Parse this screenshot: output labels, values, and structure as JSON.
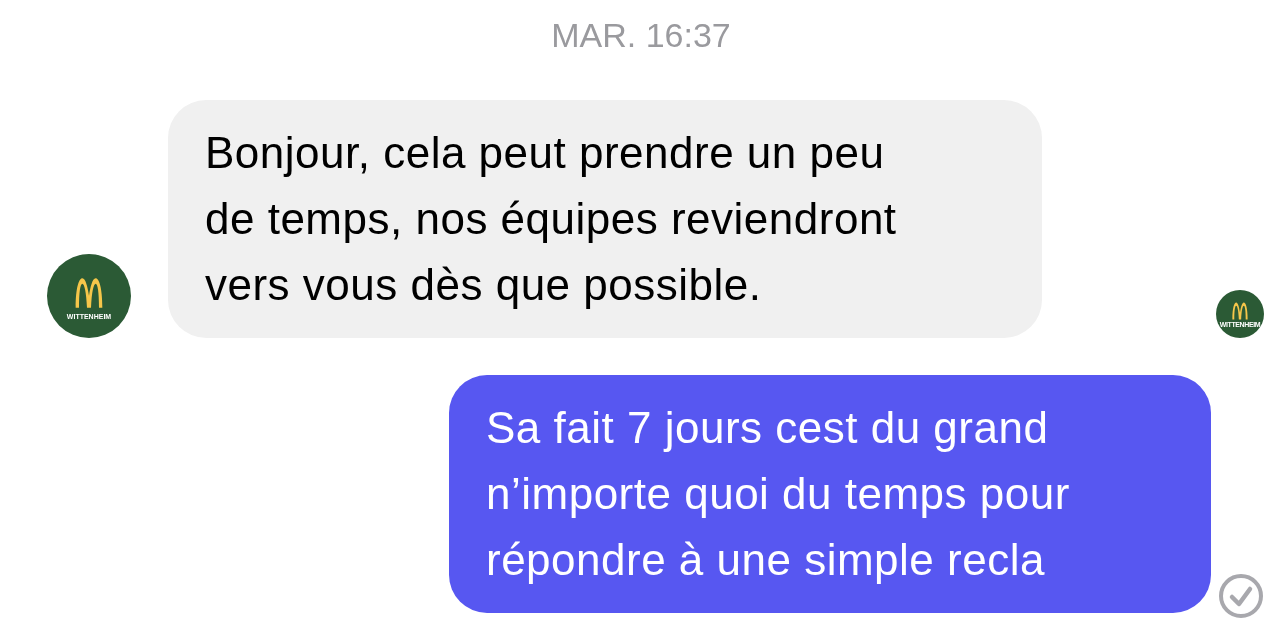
{
  "timestamp": "MAR. 16:37",
  "messages": [
    {
      "kind": "incoming",
      "text": "Bonjour, cela peut prendre un peu de temps, nos équipes reviendront vers vous dès que possible.",
      "avatar_label": "WITTENHEIM",
      "read_by_label": "WITTENHEIM"
    },
    {
      "kind": "outgoing",
      "text": "Sa fait 7 jours cest du grand n’importe quoi du temps pour répondre à une simple recla",
      "delivered": true
    }
  ]
}
